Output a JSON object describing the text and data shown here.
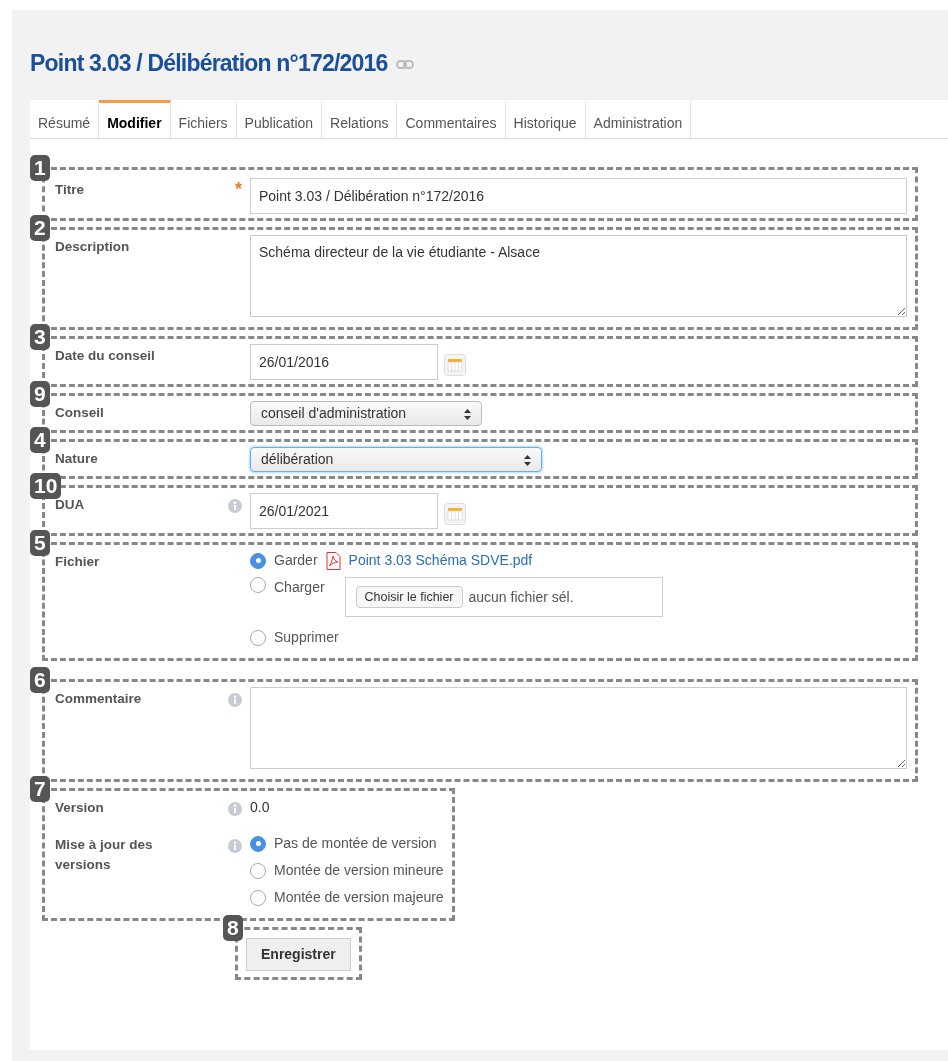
{
  "title": "Point 3.03 / Délibération n°172/2016",
  "tabs": [
    {
      "label": "Résumé",
      "selected": false
    },
    {
      "label": "Modifier",
      "selected": true
    },
    {
      "label": "Fichiers",
      "selected": false
    },
    {
      "label": "Publication",
      "selected": false
    },
    {
      "label": "Relations",
      "selected": false
    },
    {
      "label": "Commentaires",
      "selected": false
    },
    {
      "label": "Historique",
      "selected": false
    },
    {
      "label": "Administration",
      "selected": false
    }
  ],
  "sections": [
    {
      "marker": "1",
      "fields": [
        {
          "kind": "text",
          "label": "Titre",
          "required_mark": "*",
          "info": false,
          "value": "Point 3.03 / Délibération n°172/2016"
        }
      ]
    },
    {
      "marker": "2",
      "fields": [
        {
          "kind": "textarea",
          "label": "Description",
          "info": false,
          "value": "Schéma directeur de la vie étudiante - Alsace"
        }
      ]
    },
    {
      "marker": "3",
      "fields": [
        {
          "kind": "date",
          "label": "Date du conseil",
          "info": false,
          "value": "26/01/2016"
        }
      ]
    },
    {
      "marker": "9",
      "fields": [
        {
          "kind": "select",
          "label": "Conseil",
          "info": false,
          "value": "conseil d'administration",
          "focused": false
        }
      ]
    },
    {
      "marker": "4",
      "fields": [
        {
          "kind": "select",
          "label": "Nature",
          "info": false,
          "value": "délibération",
          "focused": true
        }
      ]
    },
    {
      "marker": "10",
      "fields": [
        {
          "kind": "date",
          "label": "DUA",
          "info": true,
          "value": "26/01/2021"
        }
      ]
    },
    {
      "marker": "5",
      "fields": [
        {
          "kind": "file",
          "label": "Fichier",
          "info": false,
          "options": [
            {
              "label": "Garder",
              "selected": true,
              "file_link": "Point 3.03 Schéma SDVE.pdf"
            },
            {
              "label": "Charger",
              "selected": false,
              "picker_button": "Choisir le fichier",
              "picker_status": "aucun fichier sél."
            },
            {
              "label": "Supprimer",
              "selected": false
            }
          ]
        }
      ]
    },
    {
      "marker": "6",
      "fields": [
        {
          "kind": "textarea",
          "label": "Commentaire",
          "info": true
        }
      ]
    },
    {
      "marker": "7",
      "fields": [
        {
          "kind": "static",
          "label": "Version",
          "info": true,
          "value": "0.0"
        },
        {
          "kind": "radio",
          "label": "Mise à jour des versions",
          "info": true,
          "options": [
            {
              "label": "Pas de montée de version",
              "selected": true
            },
            {
              "label": "Montée de version mineure",
              "selected": false
            },
            {
              "label": "Montée de version majeure",
              "selected": false
            }
          ]
        }
      ]
    },
    {
      "marker": "8",
      "fields": [
        {
          "kind": "button",
          "label": "Enregistrer"
        }
      ]
    }
  ]
}
